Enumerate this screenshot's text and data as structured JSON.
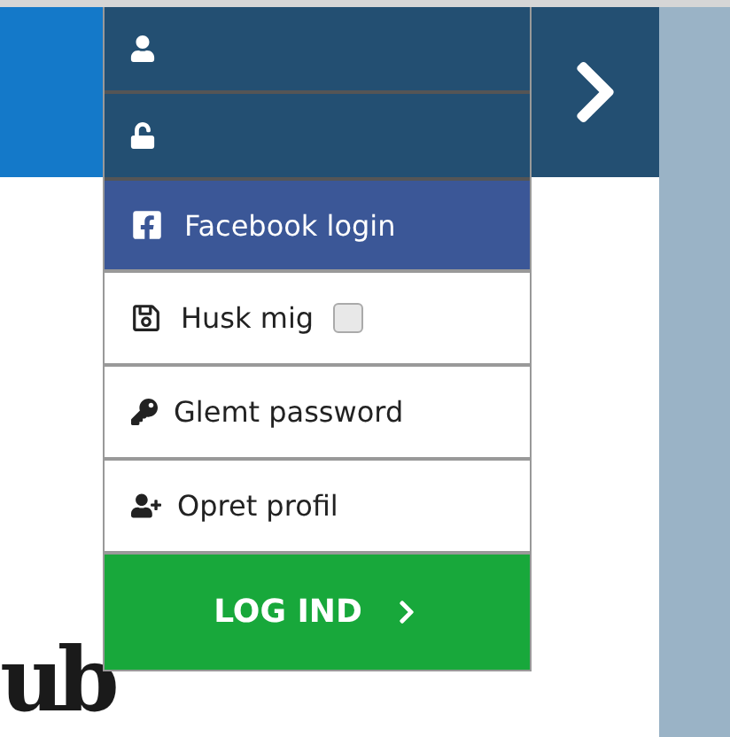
{
  "login": {
    "fields": [
      {
        "kind": "user"
      },
      {
        "kind": "password"
      }
    ],
    "facebook": {
      "label": "Facebook login"
    },
    "remember": {
      "label": "Husk mig",
      "checked": false
    },
    "links": [
      {
        "kind": "forgot",
        "label": "Glemt password"
      },
      {
        "kind": "signup",
        "label": "Opret profil"
      }
    ],
    "submit": {
      "label": "LOG IND"
    }
  },
  "logo": {
    "text": "ub"
  }
}
